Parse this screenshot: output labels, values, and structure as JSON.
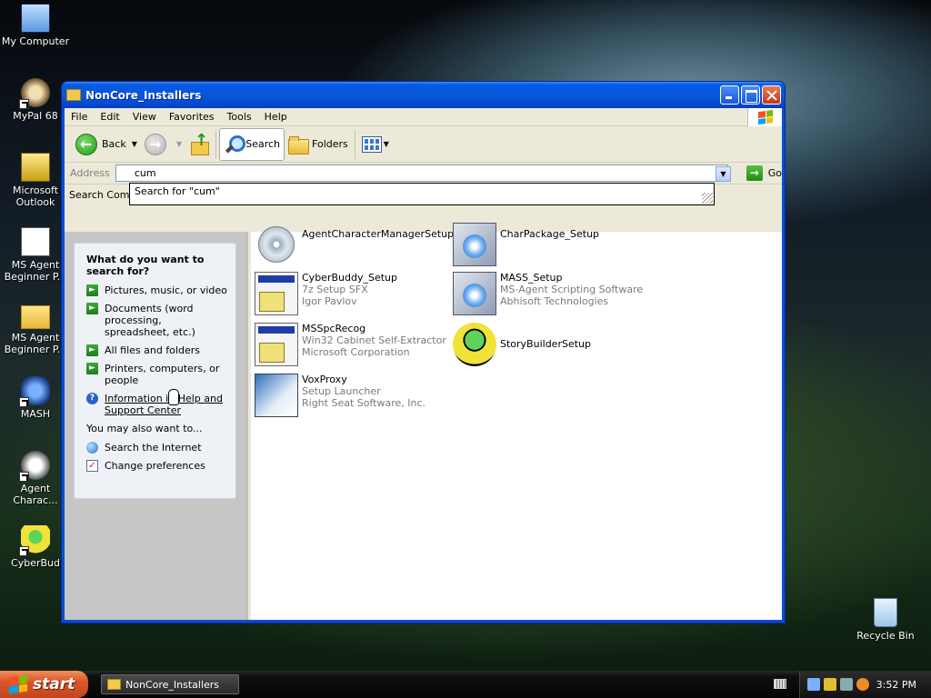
{
  "desktop": {
    "icons": [
      {
        "label": "My Computer"
      },
      {
        "label": "MyPal 68"
      },
      {
        "label": "Microsoft Outlook"
      },
      {
        "label": "MS Agent Beginner P..."
      },
      {
        "label": "MS Agent Beginner P..."
      },
      {
        "label": "MASH"
      },
      {
        "label": "Agent Charac..."
      },
      {
        "label": "CyberBud"
      },
      {
        "label": "Recycle Bin"
      }
    ]
  },
  "window": {
    "title": "NonCore_Installers",
    "menu": [
      "File",
      "Edit",
      "View",
      "Favorites",
      "Tools",
      "Help"
    ],
    "toolbar": {
      "back_label": "Back",
      "search_label": "Search",
      "folders_label": "Folders"
    },
    "address": {
      "label": "Address",
      "value": "cum",
      "go_label": "Go"
    },
    "autocomplete": {
      "suggestion": "Search for \"cum\""
    },
    "search_companion_label": "Search Compa"
  },
  "search_panel": {
    "title": "What do you want to search for?",
    "options": [
      "Pictures, music, or video",
      "Documents (word processing, spreadsheet, etc.)",
      "All files and folders",
      "Printers, computers, or people"
    ],
    "help_link": "Information in Help and Support Center",
    "also_label": "You may also want to...",
    "extra": [
      "Search the Internet",
      "Change preferences"
    ]
  },
  "files": [
    {
      "name": "AgentCharacterManagerSetup",
      "line2": "",
      "line3": "",
      "icon": "cd-icon"
    },
    {
      "name": "CharPackage_Setup",
      "line2": "",
      "line3": "",
      "icon": "package-icon"
    },
    {
      "name": "CyberBuddy_Setup",
      "line2": "7z Setup SFX",
      "line3": "Igor Pavlov",
      "icon": "installer-icon"
    },
    {
      "name": "MASS_Setup",
      "line2": "MS-Agent Scripting Software",
      "line3": "Abhisoft Technologies",
      "icon": "box-icon"
    },
    {
      "name": "MSSpcRecog",
      "line2": "Win32 Cabinet Self-Extractor",
      "line3": "Microsoft Corporation",
      "icon": "installer-icon"
    },
    {
      "name": "StoryBuilderSetup",
      "line2": "",
      "line3": "",
      "icon": "bug-icon"
    },
    {
      "name": "VoxProxy",
      "line2": "Setup Launcher",
      "line3": "Right Seat Software, Inc.",
      "icon": "vox-icon"
    }
  ],
  "taskbar": {
    "start_label": "start",
    "task_label": "NonCore_Installers",
    "clock": "3:52 PM"
  },
  "colors": {
    "titlebar_blue": "#0058e6",
    "start_orange": "#d9572a",
    "panel_blue": "#6084d8"
  }
}
